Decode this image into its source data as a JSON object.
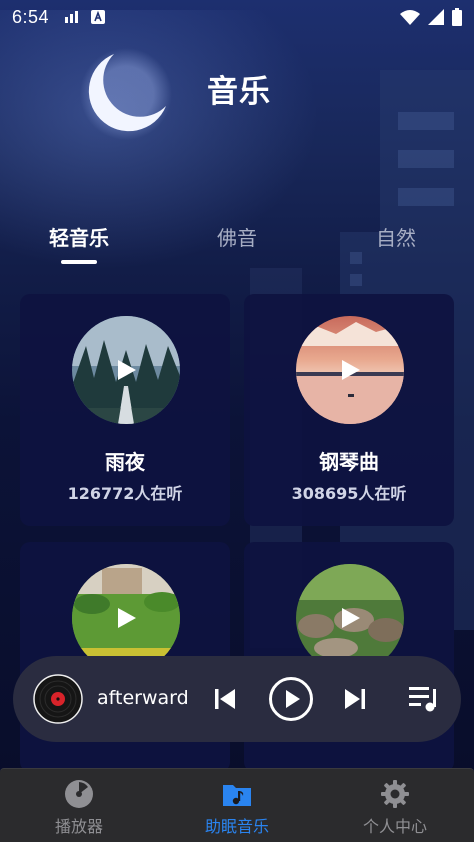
{
  "status_bar": {
    "time": "6:54"
  },
  "header": {
    "title": "音乐"
  },
  "tabs": [
    {
      "label": "轻音乐",
      "active": true
    },
    {
      "label": "佛音",
      "active": false
    },
    {
      "label": "自然",
      "active": false
    }
  ],
  "cards": [
    {
      "name": "雨夜",
      "listeners": "126772人在听",
      "art": "misty-forest-road"
    },
    {
      "name": "钢琴曲",
      "listeners": "308695人在听",
      "art": "sunset-lake"
    },
    {
      "name": "",
      "listeners": "",
      "art": "green-garden-lawn"
    },
    {
      "name": "",
      "listeners": "",
      "art": "rocky-stream"
    }
  ],
  "player": {
    "track": "afterward"
  },
  "bottom_nav": [
    {
      "label": "播放器",
      "icon": "disc-icon",
      "active": false
    },
    {
      "label": "助眠音乐",
      "icon": "music-folder-icon",
      "active": true
    },
    {
      "label": "个人中心",
      "icon": "gear-icon",
      "active": false
    }
  ],
  "colors": {
    "accent": "#2a84f0",
    "card": "#0e1240",
    "player": "#2a2c40",
    "nav": "#2b2b2d"
  }
}
